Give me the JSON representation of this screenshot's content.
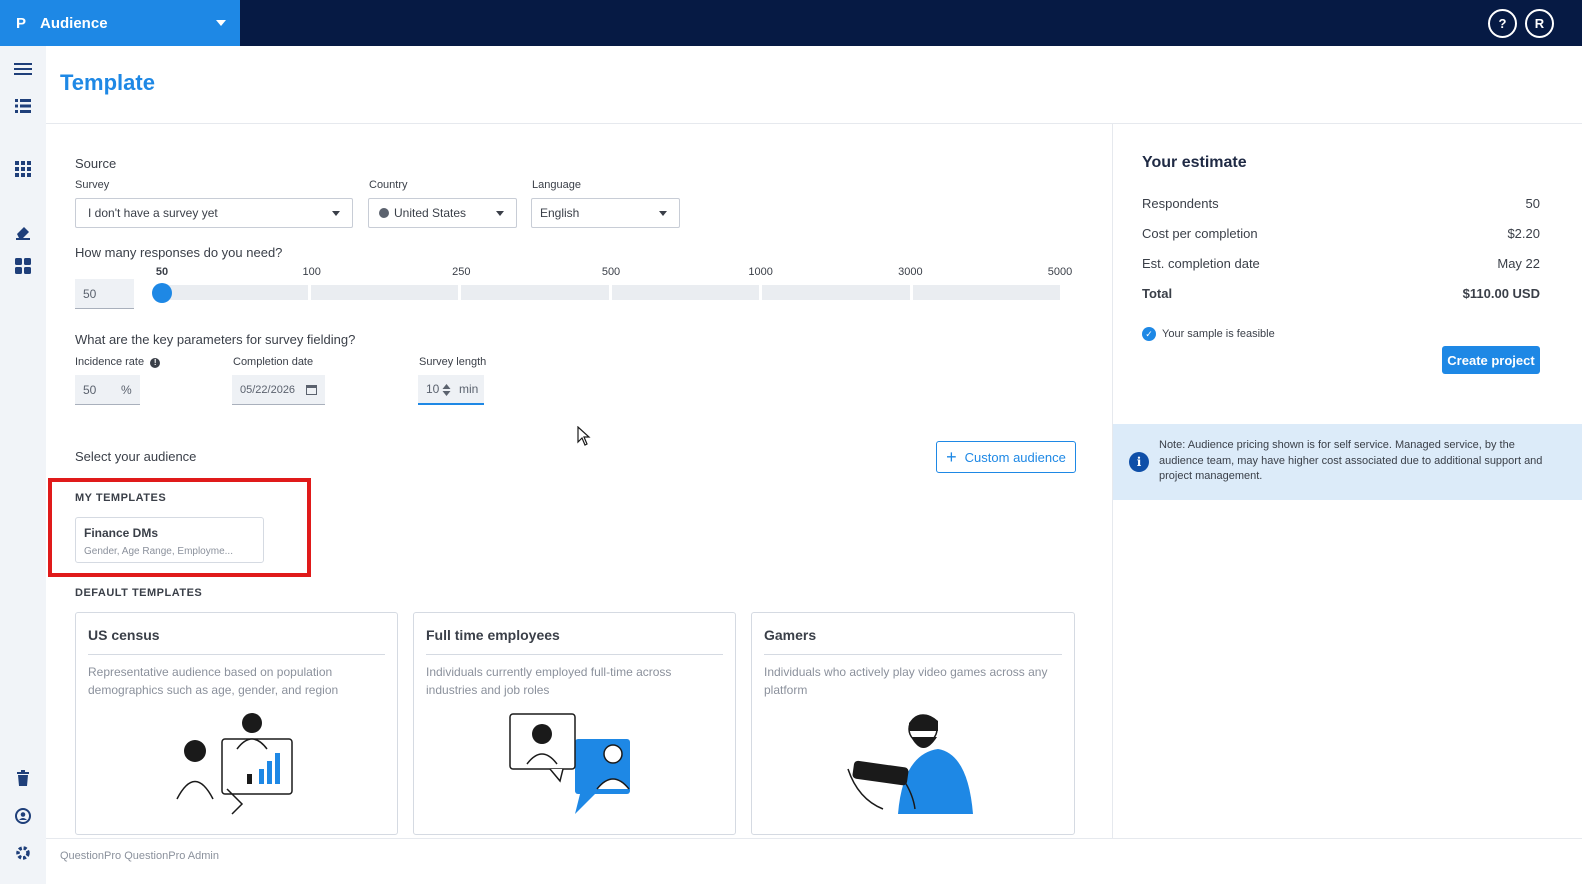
{
  "topbar": {
    "app_logo": "P",
    "app_name": "Audience",
    "help_label": "?",
    "user_initial": "R"
  },
  "sidebar": {
    "icons": [
      "menu-icon",
      "list-icon",
      "apps-grid-icon",
      "rubber-icon",
      "dashboard-icon",
      "trash-icon",
      "admin-shield-icon",
      "gear-icon"
    ]
  },
  "header": {
    "title": "Template"
  },
  "source": {
    "heading": "Source",
    "survey_label": "Survey",
    "survey_value": "I don't have a survey yet",
    "country_label": "Country",
    "country_value": "United States",
    "language_label": "Language",
    "language_value": "English"
  },
  "responses": {
    "question": "How many responses do you need?",
    "value": "50",
    "ticks": [
      "50",
      "100",
      "250",
      "500",
      "1000",
      "3000",
      "5000"
    ],
    "selected_index": 0
  },
  "parameters": {
    "question": "What are the key parameters for survey fielding?",
    "incidence_label": "Incidence rate",
    "incidence_value": "50",
    "incidence_unit": "%",
    "completion_label": "Completion date",
    "completion_value": "05/22/2026",
    "length_label": "Survey length",
    "length_value": "10",
    "length_unit": "min"
  },
  "audience": {
    "heading": "Select your audience",
    "custom_button": "Custom audience",
    "my_templates_heading": "MY TEMPLATES",
    "my_templates": [
      {
        "title": "Finance DMs",
        "subtitle": "Gender, Age Range, Employme..."
      }
    ],
    "default_templates_heading": "DEFAULT TEMPLATES",
    "default_templates": [
      {
        "title": "US census",
        "desc": "Representative audience based on population demographics such as age, gender, and region"
      },
      {
        "title": "Full time employees",
        "desc": "Individuals currently employed full-time across industries and job roles"
      },
      {
        "title": "Gamers",
        "desc": "Individuals who actively play video games across any platform"
      }
    ]
  },
  "estimate": {
    "title": "Your estimate",
    "rows": [
      {
        "label": "Respondents",
        "value": "50"
      },
      {
        "label": "Cost per completion",
        "value": "$2.20"
      },
      {
        "label": "Est. completion date",
        "value": "May 22"
      },
      {
        "label": "Total",
        "value": "$110.00 USD"
      }
    ],
    "feasible_text": "Your sample is feasible",
    "create_button": "Create project",
    "note": "Note: Audience pricing shown is for self service. Managed service, by the audience team, may have higher cost associated due to additional support and project management."
  },
  "footer": {
    "text": "QuestionPro QuestionPro Admin"
  },
  "colors": {
    "accent": "#1e88e5",
    "topbar": "#061a44",
    "highlight": "#e01a1a",
    "note_bg": "#dcebf9"
  }
}
